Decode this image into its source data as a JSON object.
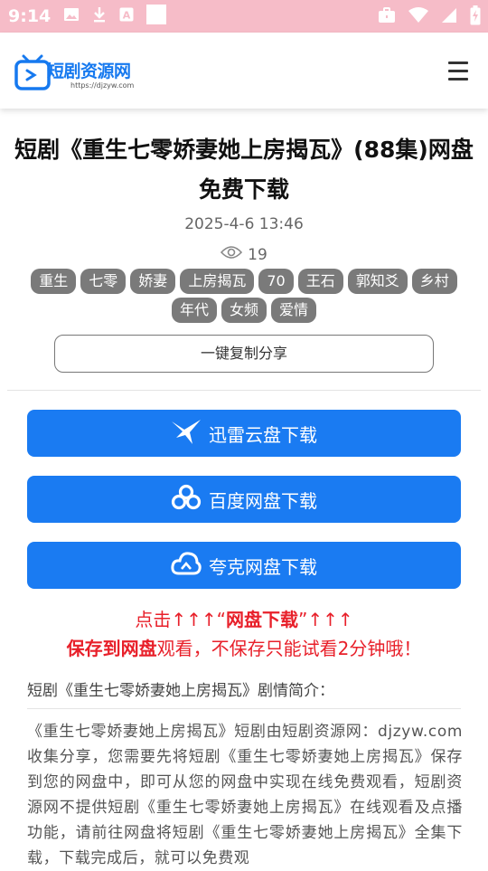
{
  "status_bar": {
    "time": "9:14",
    "icons_left": [
      "image-icon",
      "download-icon",
      "a-icon",
      "square-icon"
    ],
    "icons_right": [
      "briefcase-icon",
      "wifi-icon",
      "signal-icon",
      "battery-icon"
    ]
  },
  "header": {
    "logo_text": "短剧资源网",
    "logo_url": "https://djzyw.com",
    "menu_icon": "hamburger-menu-icon"
  },
  "article": {
    "title": "短剧《重生七零娇妻她上房揭瓦》(88集)网盘免费下载",
    "date": "2025-4-6 13:46",
    "views": "19",
    "tags": [
      "重生",
      "七零",
      "娇妻",
      "上房揭瓦",
      "70",
      "王石",
      "郭知爻",
      "乡村",
      "年代",
      "女频",
      "爱情"
    ],
    "share_label": "一键复制分享"
  },
  "downloads": [
    {
      "label": "迅雷云盘下载",
      "icon": "thunder-bird-icon"
    },
    {
      "label": "百度网盘下载",
      "icon": "baidu-cloud-icon"
    },
    {
      "label": "夸克网盘下载",
      "icon": "quark-cloud-icon"
    }
  ],
  "notice": {
    "line1_pre": "点击↑↑↑“",
    "line1_bold": "网盘下载",
    "line1_post": "”↑↑↑",
    "line2_bold": "保存到网盘",
    "line2_rest": "观看，不保存只能试看2分钟哦！"
  },
  "synopsis": {
    "heading": "短剧《重生七零娇妻她上房揭瓦》剧情简介：",
    "text": "《重生七零娇妻她上房揭瓦》短剧由短剧资源网：djzyw.com 收集分享，您需要先将短剧《重生七零娇妻她上房揭瓦》保存到您的网盘中，即可从您的网盘中实现在线免费观看，短剧资源网不提供短剧《重生七零娇妻她上房揭瓦》在线观看及点播功能，请前往网盘将短剧《重生七零娇妻她上房揭瓦》全集下载，下载完成后，就可以免费观"
  },
  "colors": {
    "status_bar": "#f6bcc8",
    "brand_blue": "#1a7bf2",
    "tag_gray": "#7a7a7a",
    "notice_red": "#e8202a"
  }
}
